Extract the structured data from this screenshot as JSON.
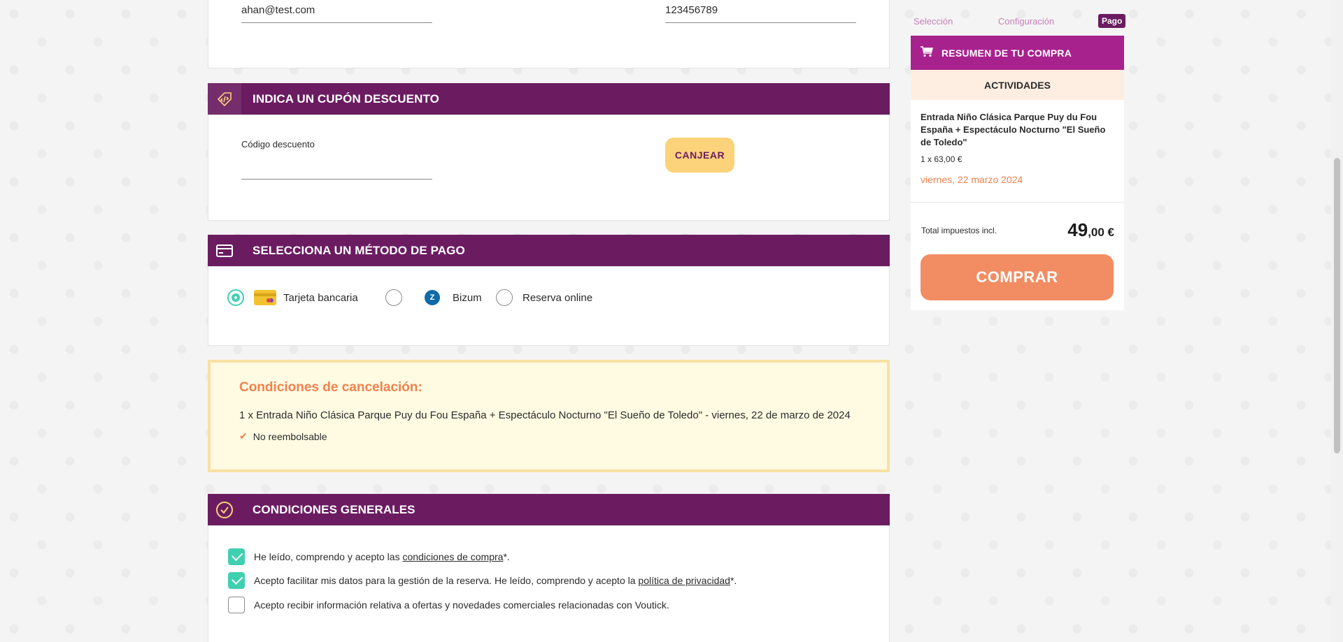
{
  "contact": {
    "email_value": "ahan@test.com",
    "phone_value": "123456789"
  },
  "coupon": {
    "header": "INDICA UN CUPÓN DESCUENTO",
    "label": "Código descuento",
    "value": "",
    "button": "CANJEAR",
    "icon": "coupon-code-icon"
  },
  "payment": {
    "header": "SELECCIONA UN MÉTODO DE PAGO",
    "icon": "credit-card-icon",
    "options": [
      {
        "label": "Tarjeta bancaria",
        "selected": true,
        "icon": "bank-card-icon"
      },
      {
        "label": "Bizum",
        "selected": false,
        "icon": "bizum-logo-icon"
      },
      {
        "label": "Reserva online",
        "selected": false
      }
    ],
    "bizum_glyph": "Z"
  },
  "cancellation": {
    "title": "Condiciones de cancelación:",
    "line": "1 x Entrada Niño Clásica Parque Puy du Fou España + Espectáculo Nocturno \"El Sueño de Toledo\" - viernes, 22 de marzo de 2024",
    "policy": "No reembolsable",
    "accent_color": "#f0824f"
  },
  "general": {
    "header": "CONDICIONES GENERALES",
    "icon": "check-circle-icon",
    "rows": [
      {
        "before": "He leído, comprendo y acepto las ",
        "link": "condiciones de compra",
        "after": "*.",
        "checked": true
      },
      {
        "before": "Acepto facilitar mis datos para la gestión de la reserva. He leído, comprendo y acepto la ",
        "link": "política de privacidad",
        "after": "*.",
        "checked": true
      },
      {
        "before": "Acepto recibir información relativa a ofertas y novedades comerciales relacionadas con Voutick.",
        "link": "",
        "after": "",
        "checked": false
      }
    ]
  },
  "steps": [
    "Selección",
    "Configuración",
    "Pago"
  ],
  "summary": {
    "header": "RESUMEN DE TU COMPRA",
    "activities": "ACTIVIDADES",
    "item_name": "Entrada Niño Clásica Parque Puy du Fou España + Espectáculo Nocturno \"El Sueño de Toledo\"",
    "item_qty": "1 x 63,00 €",
    "item_date": "viernes, 22 marzo 2024",
    "total_label": "Total impuestos incl.",
    "total_int": "49",
    "total_dec": ",00 €",
    "buy_button": "COMPRAR"
  },
  "colors": {
    "header_purple": "#6b1c61",
    "summary_magenta": "#a8228e",
    "buy_orange": "#f28c62",
    "check_teal": "#3fd0b0",
    "coupon_yellow": "#fcd27a"
  }
}
